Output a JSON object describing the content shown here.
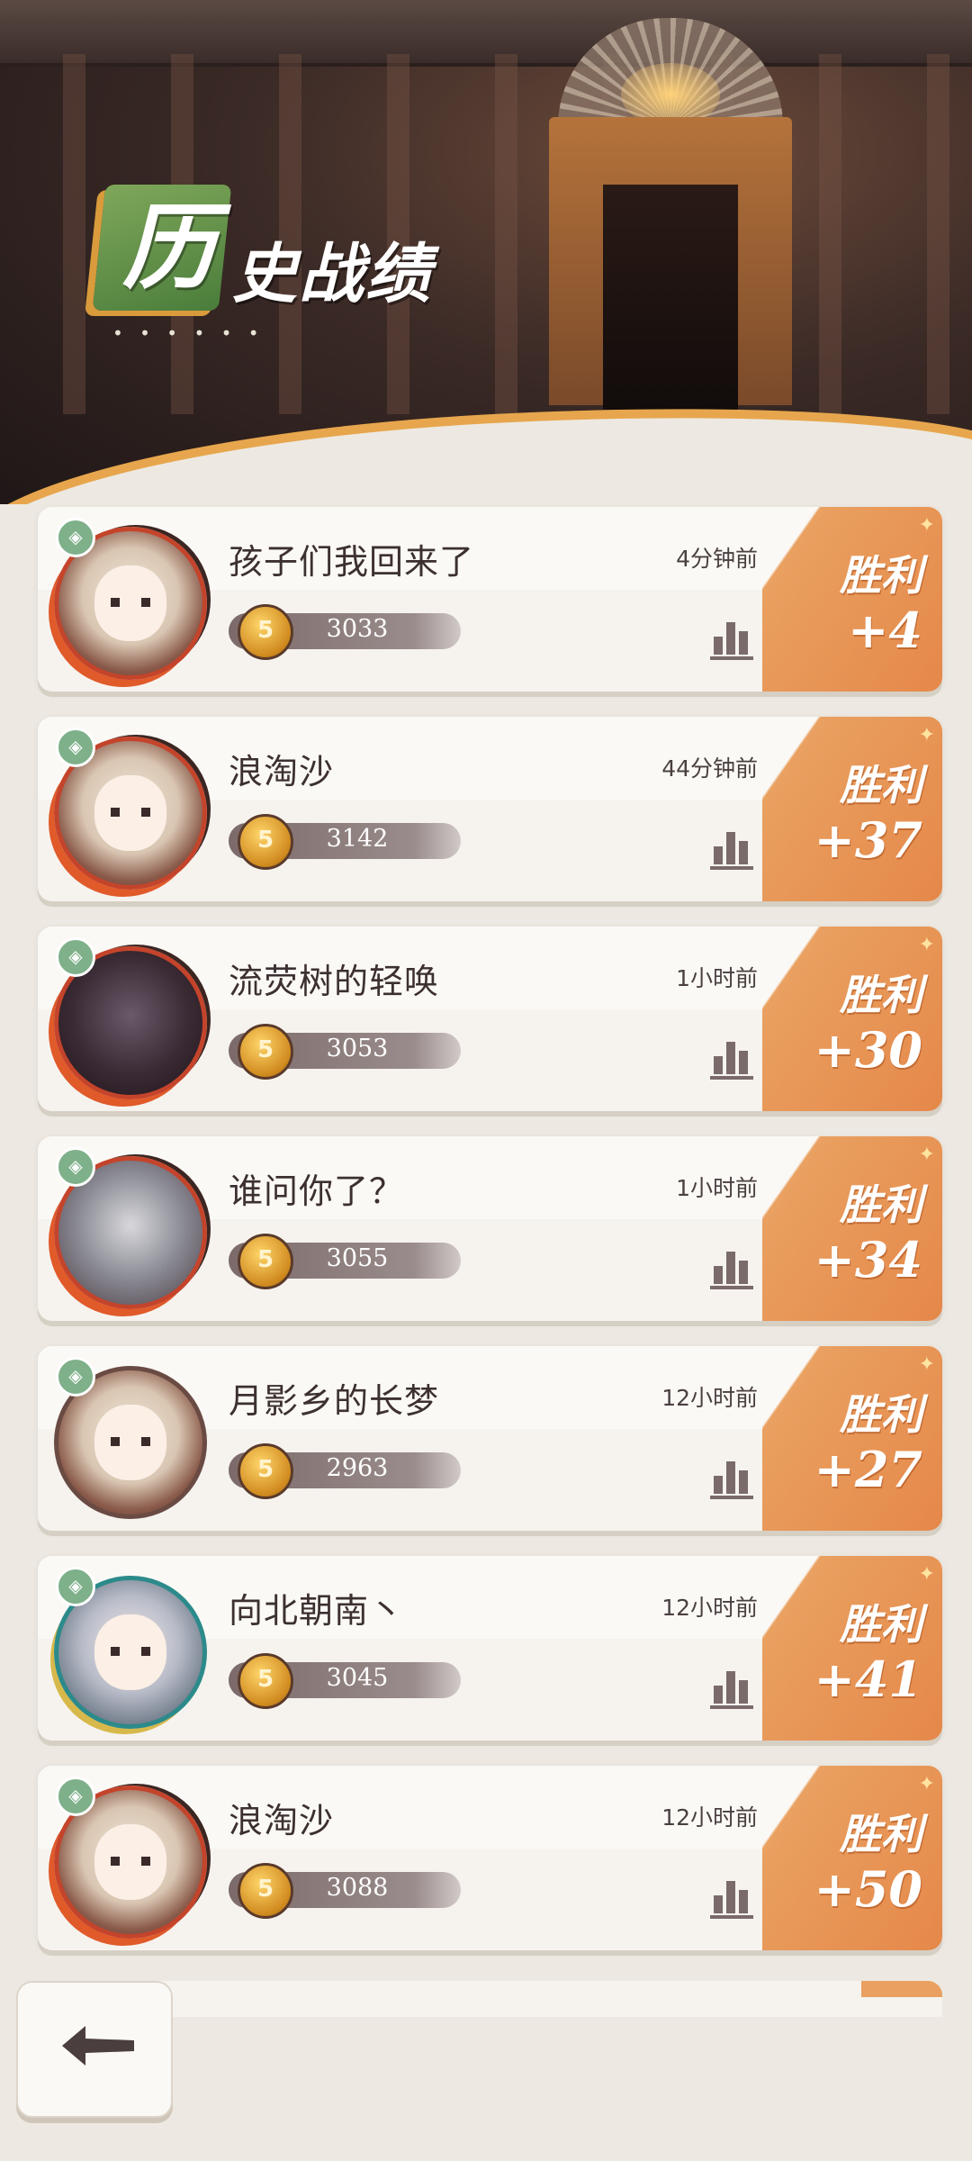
{
  "header": {
    "title_first_char": "历",
    "title_rest": "史战绩",
    "decoration_dots": "• • • • • •"
  },
  "records": [
    {
      "name": "孩子们我回来了",
      "time": "4分钟前",
      "score": "3033",
      "result": "胜利",
      "delta": "+4",
      "avatar": "elf-warrior"
    },
    {
      "name": "浪淘沙",
      "time": "44分钟前",
      "score": "3142",
      "result": "胜利",
      "delta": "+37",
      "avatar": "white-cat"
    },
    {
      "name": "流荧树的轻唤",
      "time": "1小时前",
      "score": "3053",
      "result": "胜利",
      "delta": "+30",
      "avatar": "dark-mask"
    },
    {
      "name": "谁问你了？",
      "time": "1小时前",
      "score": "3055",
      "result": "胜利",
      "delta": "+34",
      "avatar": "grey-wolf"
    },
    {
      "name": "月影乡的长梦",
      "time": "12小时前",
      "score": "2963",
      "result": "胜利",
      "delta": "+27",
      "avatar": "horned-girl"
    },
    {
      "name": "向北朝南丶",
      "time": "12小时前",
      "score": "3045",
      "result": "胜利",
      "delta": "+41",
      "avatar": "silver-hair"
    },
    {
      "name": "浪淘沙",
      "time": "12小时前",
      "score": "3088",
      "result": "胜利",
      "delta": "+50",
      "avatar": "white-cat"
    }
  ],
  "icons": {
    "badge": "shield-icon",
    "medal": "medal-icon",
    "stats": "bar-chart-icon",
    "back": "back-arrow-icon"
  },
  "colors": {
    "victory": "#e5884a",
    "card": "#f6f3ef",
    "background": "#ede9e2",
    "title_badge": "#5a8d45"
  },
  "medal_glyph": "5"
}
